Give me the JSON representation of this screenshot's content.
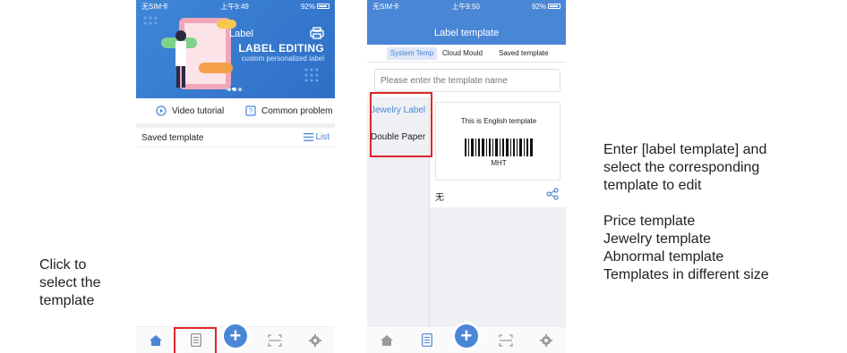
{
  "left_caption": [
    "Click to",
    "select the",
    "template"
  ],
  "right_caption": {
    "line1": "Enter [label template] and",
    "line2": "select the corresponding",
    "line3": "template to edit",
    "items": [
      "Price template",
      "Jewelry template",
      "Abnormal template",
      "Templates in different size"
    ]
  },
  "screen1": {
    "status": {
      "carrier": "无SIM卡",
      "time": "上午9:49",
      "battery": "92%"
    },
    "banner": {
      "brand": "Label",
      "title": "LABEL EDITING",
      "subtitle": "custom personalized label",
      "color": "#3f86d8"
    },
    "video_tutorial": "Video tutorial",
    "common_problem": "Common problem",
    "saved_template": "Saved template",
    "list_label": "List"
  },
  "screen2": {
    "status": {
      "carrier": "无SIM卡",
      "time": "上午9:50",
      "battery": "92%"
    },
    "header_title": "Label template",
    "tabs": [
      "System Temp",
      "Cloud Mould",
      "Saved template"
    ],
    "search_placeholder": "Please enter the template name",
    "categories": [
      "Jewelry Label",
      "Double Paper"
    ],
    "card": {
      "heading": "This is English template",
      "barcode_text": "MHT",
      "footer": "无"
    }
  },
  "colors": {
    "accent": "#4a86d6",
    "highlight": "#e0262b"
  }
}
